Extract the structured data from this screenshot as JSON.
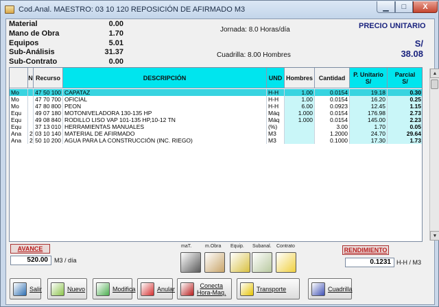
{
  "window": {
    "title": "Cod.Anal. MAESTRO: 03 10 120    REPOSICIÓN DE AFIRMADO    M3",
    "min_glyph": "▁",
    "max_glyph": "□",
    "close_glyph": "X"
  },
  "summary": {
    "rows": [
      {
        "label": "Material",
        "value": "0.00"
      },
      {
        "label": "Mano de Obra",
        "value": "1.70"
      },
      {
        "label": "Equipos",
        "value": "5.01"
      },
      {
        "label": "Sub-Análisis",
        "value": "31.37"
      },
      {
        "label": "Sub-Contrato",
        "value": "0.00"
      }
    ],
    "jornada": "Jornada:  8.0 Horas/día",
    "cuadrilla": "Cuadrilla:  8.00  Hombres",
    "precio_label": "PRECIO UNITARIO",
    "currency": "S/",
    "precio_value": "38.08"
  },
  "grid": {
    "headers": {
      "blank": "",
      "n": "N",
      "recurso": "Recurso",
      "descripcion": "DESCRIPCIÓN",
      "und": "UND",
      "hombres": "Hombres",
      "cantidad": "Cantidad",
      "punitario": "P. Unitario\nS/",
      "parcial": "Parcial\nS/"
    },
    "rows": [
      {
        "t": "Mo",
        "n": "",
        "rec": "47 50 100",
        "desc": "CAPATAZ",
        "und": "H-H",
        "hom": "1.00",
        "cant": "0.0154",
        "pu": "19.18",
        "par": "0.30"
      },
      {
        "t": "Mo",
        "n": "",
        "rec": "47 70 700",
        "desc": "OFICIAL",
        "und": "H-H",
        "hom": "1.00",
        "cant": "0.0154",
        "pu": "16.20",
        "par": "0.25"
      },
      {
        "t": "Mo",
        "n": "",
        "rec": "47 80 800",
        "desc": "PEON",
        "und": "H-H",
        "hom": "6.00",
        "cant": "0.0923",
        "pu": "12.45",
        "par": "1.15"
      },
      {
        "t": "Equ",
        "n": "",
        "rec": "49 07 180",
        "desc": "MOTONIVELADORA 130-135 HP",
        "und": "Máq",
        "hom": "1.000",
        "cant": "0.0154",
        "pu": "176.98",
        "par": "2.73"
      },
      {
        "t": "Equ",
        "n": "",
        "rec": "49 08 840",
        "desc": "RODILLO LISO VAP 101-135 HP,10-12 TN",
        "und": "Máq",
        "hom": "1.000",
        "cant": "0.0154",
        "pu": "145.00",
        "par": "2.23"
      },
      {
        "t": "Equ",
        "n": "",
        "rec": "37 13 010",
        "desc": "HERRAMIENTAS MANUALES",
        "und": "(%)",
        "hom": "",
        "cant": "3.00",
        "pu": "1.70",
        "par": "0.05"
      },
      {
        "t": "Ana",
        "n": "2",
        "rec": "03 10 140",
        "desc": "MATERIAL DE AFIRMADO",
        "und": "M3",
        "hom": "",
        "cant": "1.2000",
        "pu": "24.70",
        "par": "29.64"
      },
      {
        "t": "Ana",
        "n": "2",
        "rec": "50 10 200",
        "desc": "AGUA PARA LA CONSTRUCCIÓN (INC. RIEGO)",
        "und": "M3",
        "hom": "",
        "cant": "0.1000",
        "pu": "17.30",
        "par": "1.73"
      }
    ]
  },
  "avance": {
    "label": "AVANCE",
    "value": "520.00",
    "unit": "M3  / día"
  },
  "rendimiento": {
    "label": "RENDIMIENTO",
    "value": "0.1231",
    "unit": "H-H / M3"
  },
  "tools": [
    {
      "label": "maT.",
      "icon": "material-icon",
      "color": "#5a5a5a"
    },
    {
      "label": "m.Obra",
      "icon": "workers-icon",
      "color": "#c9a56a"
    },
    {
      "label": "Equip.",
      "icon": "equipment-icon",
      "color": "#d8c040"
    },
    {
      "label": "Subanal.",
      "icon": "subanalysis-icon",
      "color": "#b9c9a0"
    },
    {
      "label": "Contrato",
      "icon": "contract-icon",
      "color": "#f0d040"
    }
  ],
  "buttons": [
    {
      "label": "Salir",
      "icon": "exit-icon",
      "color": "#2e6fb3"
    },
    {
      "label": "Nuevo",
      "icon": "new-icon",
      "color": "#8bc34a"
    },
    {
      "label": "Modifica",
      "icon": "edit-icon",
      "color": "#4caf50"
    },
    {
      "label": "Anular",
      "icon": "delete-icon",
      "color": "#d32f2f"
    },
    {
      "label": "Conecta\nHora-Maq.",
      "icon": "clock-icon",
      "color": "#b71c1c"
    },
    {
      "label": "Transporte",
      "icon": "truck-icon",
      "color": "#e6c300"
    },
    {
      "label": "Cuadrilla",
      "icon": "crew-icon",
      "color": "#3f51b5"
    }
  ]
}
